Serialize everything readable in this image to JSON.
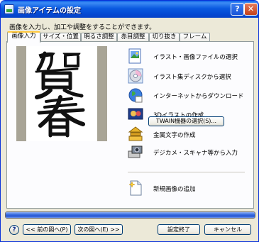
{
  "window": {
    "title": "画像アイテムの設定",
    "help_glyph": "?",
    "close_glyph": "✕"
  },
  "description": "画像を入力し、加工や調整をすることができます。",
  "tabs": [
    {
      "label": "画像入力",
      "active": true
    },
    {
      "label": "サイズ・位置",
      "active": false
    },
    {
      "label": "明るさ調整",
      "active": false
    },
    {
      "label": "赤目調整",
      "active": false
    },
    {
      "label": "切り抜き",
      "active": false
    },
    {
      "label": "フレーム",
      "active": false
    }
  ],
  "menu": [
    {
      "label": "イラスト・画像ファイルの選択",
      "icon": "image-file-icon"
    },
    {
      "label": "イラスト集ディスクから選択",
      "icon": "cd-disc-icon"
    },
    {
      "label": "インターネットからダウンロード",
      "icon": "globe-icon"
    },
    {
      "label": "3Dイラストの作成",
      "icon": "3d-illustration-icon"
    },
    {
      "label": "金属文字の作成",
      "icon": "metal-text-icon"
    },
    {
      "label": "デジカメ・スキャナ等から入力",
      "icon": "camera-scanner-icon"
    },
    {
      "label": "新規画像の追加",
      "icon": "new-image-icon"
    }
  ],
  "twain_button": "TWAIN機器の選択(S)...",
  "progress": {
    "fraction": 1.0
  },
  "buttons": {
    "help": "?",
    "prev": "<< 前の図へ(P)",
    "next": "次の図へ(E) >>",
    "finish": "設定終了",
    "cancel": "キャンセル"
  },
  "colors": {
    "title_bar": "#0a5ae0",
    "dialog_bg": "#ece9d8",
    "active_tab_accent": "#ffc83c",
    "progress": "#2453d0"
  }
}
